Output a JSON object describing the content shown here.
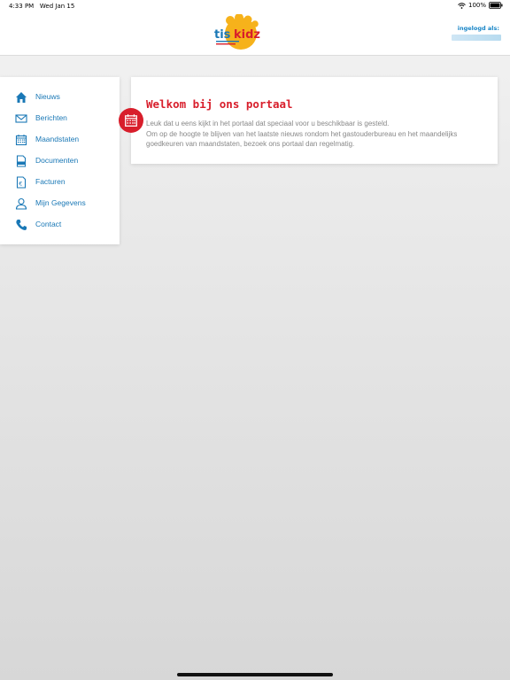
{
  "status_bar": {
    "time": "4:33 PM",
    "date": "Wed Jan 15",
    "battery": "100%"
  },
  "header": {
    "logo_text": "tis kidz",
    "login_label": "ingelogd als:"
  },
  "sidebar": {
    "items": [
      {
        "label": "Nieuws",
        "icon": "home-icon"
      },
      {
        "label": "Berichten",
        "icon": "envelope-icon"
      },
      {
        "label": "Maandstaten",
        "icon": "calendar-icon"
      },
      {
        "label": "Documenten",
        "icon": "document-icon"
      },
      {
        "label": "Facturen",
        "icon": "invoice-icon"
      },
      {
        "label": "Mijn Gegevens",
        "icon": "user-icon"
      },
      {
        "label": "Contact",
        "icon": "phone-icon"
      }
    ]
  },
  "welcome": {
    "title": "Welkom bij ons portaal",
    "line1": "Leuk dat u eens kijkt in het portaal dat speciaal voor u beschikbaar is gesteld.",
    "line2": "Om op de hoogte te blijven van het laatste nieuws rondom het gastouderbureau en het maandelijks goedkeuren van maandstaten, bezoek ons portaal dan regelmatig.",
    "icon": "calendar-icon"
  },
  "colors": {
    "accent_blue": "#1a78b6",
    "accent_red": "#d81e2b"
  }
}
